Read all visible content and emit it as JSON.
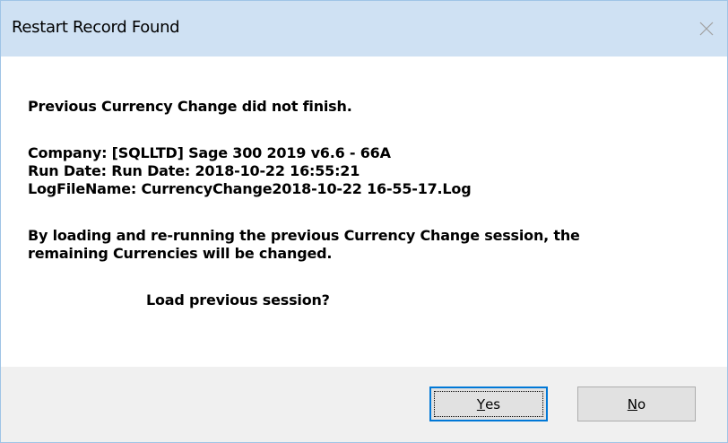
{
  "dialog": {
    "title": "Restart Record Found",
    "close_icon": "close-icon"
  },
  "message": {
    "line1": "Previous Currency Change did not finish.",
    "company": "Company:  [SQLLTD] Sage 300 2019 v6.6  - 66A",
    "run_date": "Run Date: Run Date: 2018-10-22  16:55:21",
    "log_file": "LogFileName: CurrencyChange2018-10-22 16-55-17.Log",
    "explain_line1": "By loading and re-running the previous Currency  Change session, the",
    "explain_line2": "remaining Currencies  will be changed.",
    "question": "Load previous session?"
  },
  "buttons": {
    "yes": {
      "accel": "Y",
      "rest": "es"
    },
    "no": {
      "accel": "N",
      "rest": "o"
    }
  },
  "colors": {
    "titlebar": "#cfe1f3",
    "border": "#9fc4e6",
    "footer": "#f0f0f0",
    "default_button_border": "#0078d7"
  }
}
